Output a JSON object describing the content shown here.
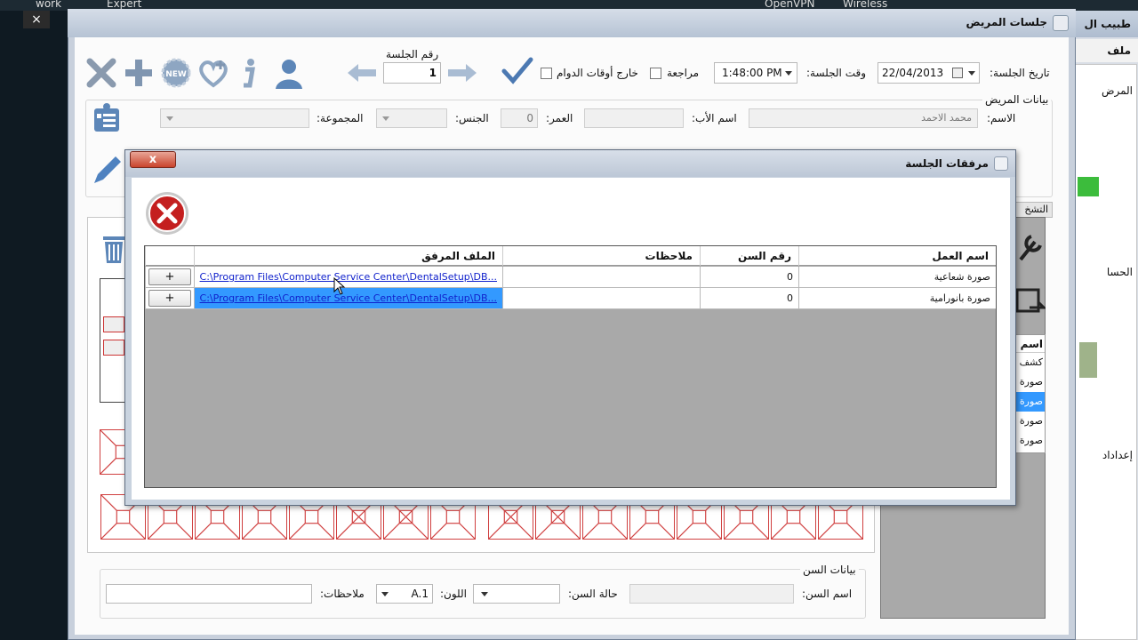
{
  "desktop": {
    "items": [
      "work",
      "Expert",
      "OpenVPN",
      "Wireless"
    ],
    "close_glyph": "×"
  },
  "outer_window": {
    "title": "طبيب ال",
    "menu_item": "ملف",
    "side_labels": [
      "المرض",
      "الحسا",
      "إعداداد"
    ]
  },
  "sessions_window": {
    "title": "جلسات المريض",
    "session_no_label": "رقم الجلسة",
    "session_no_value": "1",
    "outside_hours_label": "خارج أوقات الدوام",
    "review_label": "مراجعة",
    "session_time_label": "وقت الجلسة:",
    "session_time_value": "1:48:00 PM",
    "session_date_label": "تاريخ الجلسة:",
    "session_date_value": "22/04/2013",
    "patient_data_group": "بيانات المريض",
    "name_label": "الاسم:",
    "name_value": "محمد الاحمد",
    "father_label": "اسم الأب:",
    "age_label": "العمر:",
    "age_value": "0",
    "gender_label": "الجنس:",
    "group_label": "المجموعة:",
    "notes_label_partial": "ملاحظات",
    "tab_diag": "التشخ",
    "right_list": {
      "header": "اسم",
      "items": [
        "كشف",
        "صورة",
        "صورة",
        "صورة",
        "صورة"
      ]
    },
    "tooth_data_group": "بيانات السن",
    "tooth_name_label": "اسم السن:",
    "tooth_state_label": "حالة السن:",
    "color_label": "اللون:",
    "color_value": "A.1",
    "tooth_notes_label": "ملاحظات:",
    "toolbar_icons": [
      "close-x-icon",
      "add-plus-icon",
      "new-badge-icon",
      "add-heart-icon",
      "info-icon",
      "user-icon"
    ]
  },
  "dialog": {
    "title": "مرفقات الجلسة",
    "close_glyph": "x",
    "columns": {
      "work_name": "اسم العمل",
      "tooth_no": "رقم السن",
      "notes": "ملاحظات",
      "attached_file": "الملف المرفق"
    },
    "rows": [
      {
        "work_name": "صورة شعاعية",
        "tooth_no": "0",
        "notes": "",
        "file": "C:\\Program Files\\Computer Service Center\\DentalSetup\\DB...",
        "button": "+"
      },
      {
        "work_name": "صورة بانورامية",
        "tooth_no": "0",
        "notes": "",
        "file": "C:\\Program Files\\Computer Service Center\\DentalSetup\\DB...",
        "button": "+"
      }
    ]
  }
}
